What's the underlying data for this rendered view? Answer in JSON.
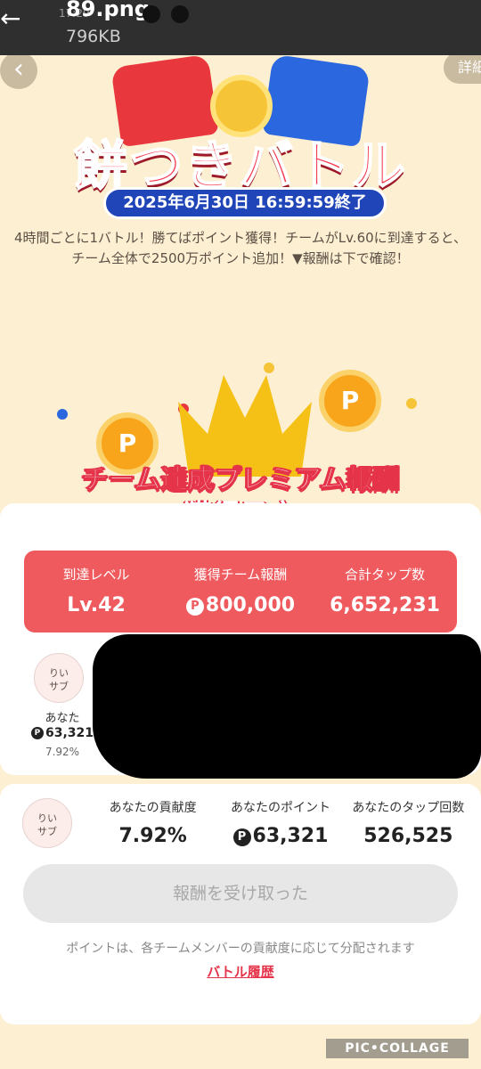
{
  "viewer": {
    "back_glyph": "←",
    "file_name": "89.png",
    "file_size": "796KB",
    "status_time": "17:29"
  },
  "page": {
    "back_glyph": "‹",
    "detail_label": "詳細"
  },
  "banner": {
    "title": "餅つきバトル",
    "end_date": "2025年6月30日 16:59:59終了"
  },
  "intro_text": "4時間ごとに1バトル！勝てばポイント獲得！チームがLv.60に到達すると、チーム全体で2500万ポイント追加！▼報酬は下で確認！",
  "reward": {
    "title": "チーム達成プレミアム報酬",
    "subtitle": "獲得予定",
    "coin_glyph": "P"
  },
  "stats": [
    {
      "label": "到達レベル",
      "value": "Lv.42",
      "has_point_icon": false
    },
    {
      "label": "獲得チーム報酬",
      "value": "800,000",
      "has_point_icon": true
    },
    {
      "label": "合計タップ数",
      "value": "6,652,231",
      "has_point_icon": false
    }
  ],
  "point_icon": "P",
  "member": {
    "avatar_text": "りい\nサブ",
    "name": "あなた",
    "points": "63,321",
    "percent": "7.92%"
  },
  "contribution": {
    "avatar_text": "りい\nサブ",
    "columns": [
      {
        "label": "あなたの貢献度",
        "value": "7.92%"
      },
      {
        "label": "あなたのポイント",
        "value": "63,321"
      },
      {
        "label": "あなたのタップ回数",
        "value": "526,525"
      }
    ],
    "claim_button": "報酬を受け取った",
    "note": "ポイントは、各チームメンバーの貢献度に応じて分配されます",
    "history_link": "バトル履歴"
  },
  "watermark": "PIC•COLLAGE",
  "colors": {
    "background": "#fdf0d2",
    "accent_red": "#ef5a5e",
    "title_red": "#f5384e",
    "date_blue": "#1f45b8",
    "coin_orange": "#f8a51c"
  }
}
